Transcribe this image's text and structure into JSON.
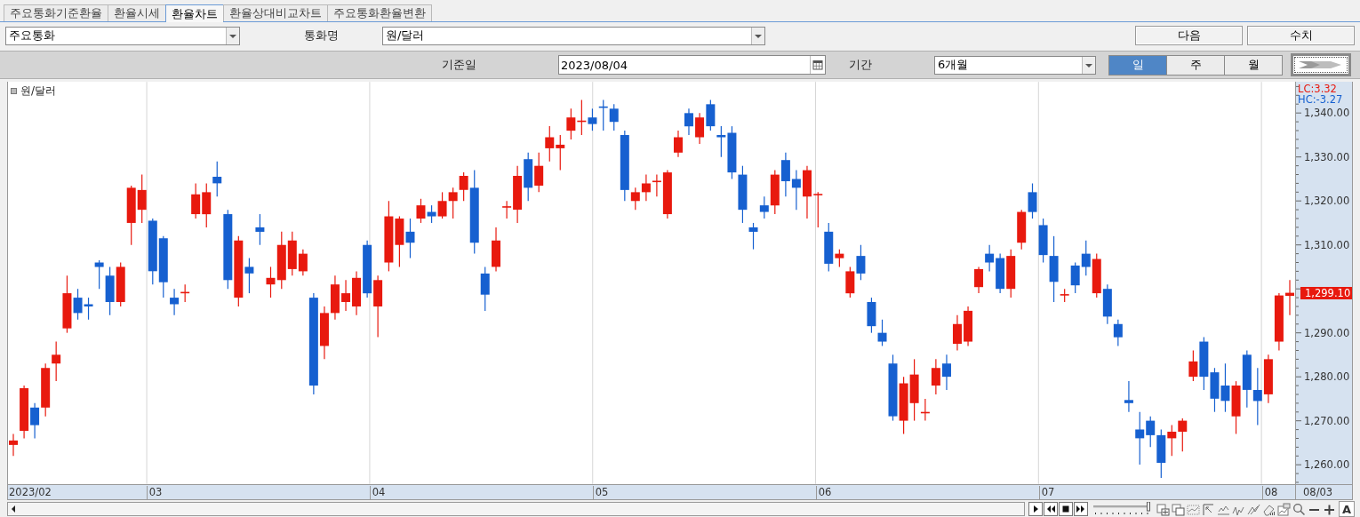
{
  "tabs": [
    {
      "label": "주요통화기준환율",
      "selected": false
    },
    {
      "label": "환율시세",
      "selected": false
    },
    {
      "label": "환율차트",
      "selected": true
    },
    {
      "label": "환율상대비교차트",
      "selected": false
    },
    {
      "label": "주요통화환율변환",
      "selected": false
    }
  ],
  "filter_bar": {
    "category_select": {
      "value": "주요통화"
    },
    "currency_label": "통화명",
    "currency_select": {
      "value": "원/달러"
    },
    "buttons": [
      "다음",
      "수치"
    ]
  },
  "query_bar": {
    "date_label": "기준일",
    "date_field": {
      "value": "2023/08/04"
    },
    "period_label": "기간",
    "period_select": {
      "value": "6개월"
    },
    "interval_tabs": [
      {
        "label": "일",
        "selected": true
      },
      {
        "label": "주",
        "selected": false
      },
      {
        "label": "월",
        "selected": false
      }
    ]
  },
  "chart": {
    "x_axis_start_label": "2023/02",
    "lc_label": "LC:3.32",
    "hc_label": "HC:-3.27",
    "price_tag": "1,299.10",
    "axis_corner_label": "08/03",
    "chart_data": {
      "type": "candlestick",
      "title": "원/달러",
      "ylim": [
        1255.6,
        1347.1
      ],
      "yticks": [
        {
          "value": 1260,
          "label": "1,260.00"
        },
        {
          "value": 1270,
          "label": "1,270.00"
        },
        {
          "value": 1280,
          "label": "1,280.00"
        },
        {
          "value": 1290,
          "label": "1,290.00"
        },
        {
          "value": 1310,
          "label": "1,310.00"
        },
        {
          "value": 1320,
          "label": "1,320.00"
        },
        {
          "value": 1330,
          "label": "1,330.00"
        },
        {
          "value": 1340,
          "label": "1,340.00"
        }
      ],
      "xlim": [
        2.378,
        8.151
      ],
      "xticks": [
        {
          "value": 3.04,
          "label": "03"
        },
        {
          "value": 4.04,
          "label": "04"
        },
        {
          "value": 5.04,
          "label": "05"
        },
        {
          "value": 6.04,
          "label": "06"
        },
        {
          "value": 7.04,
          "label": "07"
        },
        {
          "value": 8.04,
          "label": "08"
        }
      ],
      "x": [
        2.402,
        2.45,
        2.498,
        2.546,
        2.594,
        2.643,
        2.691,
        2.739,
        2.787,
        2.835,
        2.883,
        2.931,
        2.979,
        3.027,
        3.075,
        3.124,
        3.172,
        3.22,
        3.268,
        3.316,
        3.364,
        3.412,
        3.46,
        3.508,
        3.556,
        3.605,
        3.653,
        3.701,
        3.749,
        3.797,
        3.845,
        3.893,
        3.941,
        3.989,
        4.037,
        4.086,
        4.134,
        4.182,
        4.23,
        4.278,
        4.326,
        4.374,
        4.422,
        4.47,
        4.518,
        4.567,
        4.615,
        4.663,
        4.711,
        4.759,
        4.807,
        4.855,
        4.903,
        4.951,
        4.999,
        5.048,
        5.096,
        5.144,
        5.192,
        5.24,
        5.288,
        5.336,
        5.384,
        5.432,
        5.48,
        5.529,
        5.577,
        5.625,
        5.673,
        5.721,
        5.77,
        5.818,
        5.866,
        5.914,
        5.962,
        6.011,
        6.059,
        6.107,
        6.155,
        6.203,
        6.251,
        6.299,
        6.347,
        6.395,
        6.443,
        6.492,
        6.54,
        6.588,
        6.636,
        6.684,
        6.732,
        6.78,
        6.828,
        6.876,
        6.924,
        6.973,
        7.021,
        7.069,
        7.117,
        7.165,
        7.213,
        7.261,
        7.309,
        7.357,
        7.405,
        7.454,
        7.502,
        7.55,
        7.598,
        7.646,
        7.694,
        7.742,
        7.79,
        7.838,
        7.886,
        7.935,
        7.983,
        8.031,
        8.079,
        8.127
      ],
      "ohlc": [
        [
          1264.5,
          1267,
          1262,
          1265.5
        ],
        [
          1267.7,
          1278,
          1266,
          1277.4
        ],
        [
          1273,
          1274,
          1266,
          1269
        ],
        [
          1273,
          1283,
          1271,
          1282
        ],
        [
          1283,
          1288,
          1279,
          1285
        ],
        [
          1291,
          1303,
          1290,
          1299
        ],
        [
          1298,
          1300,
          1293,
          1294.5
        ],
        [
          1296.5,
          1298,
          1293,
          1296
        ],
        [
          1306,
          1306.5,
          1300,
          1305
        ],
        [
          1303,
          1305,
          1294,
          1297
        ],
        [
          1297,
          1306,
          1296,
          1305
        ],
        [
          1315,
          1323.5,
          1310,
          1323
        ],
        [
          1318,
          1326,
          1315,
          1322.5
        ],
        [
          1315.5,
          1316,
          1301,
          1304
        ],
        [
          1311.5,
          1312,
          1298,
          1301.5
        ],
        [
          1298,
          1300,
          1294,
          1296.5
        ],
        [
          1299,
          1301,
          1297,
          1299.3
        ],
        [
          1317,
          1324,
          1316,
          1321.5
        ],
        [
          1317,
          1324,
          1314,
          1322
        ],
        [
          1325.5,
          1329,
          1321,
          1324
        ],
        [
          1317,
          1318,
          1300,
          1302
        ],
        [
          1298,
          1312,
          1296,
          1311
        ],
        [
          1305,
          1307,
          1299,
          1303.5
        ],
        [
          1314,
          1317,
          1310,
          1313
        ],
        [
          1301,
          1305,
          1298,
          1302.5
        ],
        [
          1302,
          1313,
          1300,
          1310
        ],
        [
          1304.5,
          1313,
          1303,
          1311
        ],
        [
          1304,
          1309,
          1303,
          1308
        ],
        [
          1298,
          1299,
          1276,
          1278
        ],
        [
          1287,
          1296,
          1284,
          1294.5
        ],
        [
          1294.5,
          1303,
          1293,
          1301
        ],
        [
          1297,
          1302,
          1295,
          1299
        ],
        [
          1296,
          1304,
          1294,
          1302.5
        ],
        [
          1310,
          1311,
          1298,
          1299
        ],
        [
          1296,
          1303,
          1289,
          1302
        ],
        [
          1306,
          1320,
          1304,
          1316.5
        ],
        [
          1310,
          1316.5,
          1305,
          1316
        ],
        [
          1313,
          1316,
          1307,
          1310.5
        ],
        [
          1316,
          1320.5,
          1315,
          1319
        ],
        [
          1317.5,
          1319,
          1315,
          1316.5
        ],
        [
          1316.5,
          1322,
          1316,
          1320
        ],
        [
          1320,
          1323,
          1316,
          1322
        ],
        [
          1322.5,
          1326.5,
          1320,
          1325.7
        ],
        [
          1323,
          1327,
          1308,
          1310.5
        ],
        [
          1303.5,
          1305,
          1295,
          1298.7
        ],
        [
          1305,
          1314,
          1304,
          1311
        ],
        [
          1318.5,
          1320,
          1316,
          1318.8
        ],
        [
          1318,
          1328,
          1315,
          1325.7
        ],
        [
          1329.5,
          1331,
          1320,
          1323
        ],
        [
          1323.5,
          1331,
          1322,
          1328
        ],
        [
          1332,
          1337,
          1329,
          1334.5
        ],
        [
          1332,
          1335,
          1327,
          1332.8
        ],
        [
          1336,
          1341,
          1334,
          1339
        ],
        [
          1338,
          1343,
          1335,
          1338.3
        ],
        [
          1339,
          1341,
          1336,
          1337.5
        ],
        [
          1341.5,
          1343,
          1336,
          1341.3
        ],
        [
          1341,
          1342,
          1336,
          1338
        ],
        [
          1335,
          1336,
          1320,
          1322.5
        ],
        [
          1320,
          1323,
          1318,
          1322
        ],
        [
          1322,
          1326,
          1320,
          1324
        ],
        [
          1324.4,
          1326,
          1321,
          1324.6
        ],
        [
          1317,
          1327,
          1316,
          1326.5
        ],
        [
          1331,
          1336,
          1330,
          1334.5
        ],
        [
          1340,
          1341,
          1335,
          1337
        ],
        [
          1334.5,
          1340,
          1333,
          1339
        ],
        [
          1342,
          1343,
          1336,
          1337
        ],
        [
          1335,
          1337,
          1330,
          1334.5
        ],
        [
          1335.5,
          1337,
          1325,
          1326.5
        ],
        [
          1326,
          1328,
          1315,
          1318
        ],
        [
          1314,
          1315,
          1309,
          1313
        ],
        [
          1319,
          1321,
          1316,
          1317.5
        ],
        [
          1319,
          1327,
          1317,
          1326
        ],
        [
          1329.3,
          1331,
          1321,
          1324.5
        ],
        [
          1325,
          1327,
          1318,
          1323
        ],
        [
          1321,
          1328,
          1316,
          1327
        ],
        [
          1321.4,
          1322,
          1314,
          1321.6
        ],
        [
          1313,
          1315,
          1304,
          1305.7
        ],
        [
          1307,
          1309,
          1305,
          1308
        ],
        [
          1299,
          1305,
          1298,
          1304
        ],
        [
          1307.5,
          1310,
          1302,
          1303.5
        ],
        [
          1297,
          1298,
          1290,
          1291.5
        ],
        [
          1290,
          1293,
          1287,
          1288
        ],
        [
          1283,
          1285,
          1270,
          1271
        ],
        [
          1270,
          1280,
          1267,
          1278.5
        ],
        [
          1274,
          1284,
          1270,
          1280.5
        ],
        [
          1271.7,
          1275,
          1270,
          1272
        ],
        [
          1278,
          1284,
          1276,
          1282
        ],
        [
          1283,
          1285,
          1277,
          1280
        ],
        [
          1287.5,
          1294,
          1286,
          1292
        ],
        [
          1288,
          1296,
          1287,
          1295
        ],
        [
          1300.4,
          1305,
          1299,
          1304.5
        ],
        [
          1308,
          1310,
          1304,
          1306
        ],
        [
          1307,
          1308,
          1299,
          1300
        ],
        [
          1300,
          1309,
          1298,
          1307.5
        ],
        [
          1310.5,
          1318,
          1309,
          1317.5
        ],
        [
          1322,
          1324,
          1316,
          1317.5
        ],
        [
          1314.5,
          1316,
          1306,
          1307.7
        ],
        [
          1307.5,
          1312,
          1297,
          1301.6
        ],
        [
          1298.5,
          1300,
          1297,
          1298.8
        ],
        [
          1305.3,
          1306,
          1299,
          1300.8
        ],
        [
          1308,
          1311,
          1303,
          1305
        ],
        [
          1299,
          1308,
          1298,
          1306.8
        ],
        [
          1300,
          1301,
          1292,
          1293.7
        ],
        [
          1292,
          1293,
          1287,
          1289
        ],
        [
          1274.7,
          1279,
          1272,
          1274
        ],
        [
          1268,
          1272,
          1260,
          1266
        ],
        [
          1270,
          1271,
          1264,
          1266.7
        ],
        [
          1266.7,
          1268,
          1257,
          1260.4
        ],
        [
          1266,
          1269,
          1262,
          1267.5
        ],
        [
          1267.5,
          1270.5,
          1263,
          1270
        ],
        [
          1280,
          1286,
          1279,
          1283.5
        ],
        [
          1288,
          1289,
          1277,
          1280
        ],
        [
          1281,
          1282,
          1272,
          1275
        ],
        [
          1278,
          1283,
          1272,
          1274.5
        ],
        [
          1271,
          1279,
          1267,
          1278
        ],
        [
          1285,
          1286,
          1273,
          1277
        ],
        [
          1277,
          1282,
          1269,
          1274.5
        ],
        [
          1276,
          1285,
          1274,
          1284
        ],
        [
          1288,
          1299,
          1286,
          1298.5
        ],
        [
          1298.4,
          1302,
          1294,
          1299.1
        ]
      ]
    }
  },
  "toolbar": {
    "zoom_slider": {
      "level": 1
    },
    "font_button": "A"
  }
}
